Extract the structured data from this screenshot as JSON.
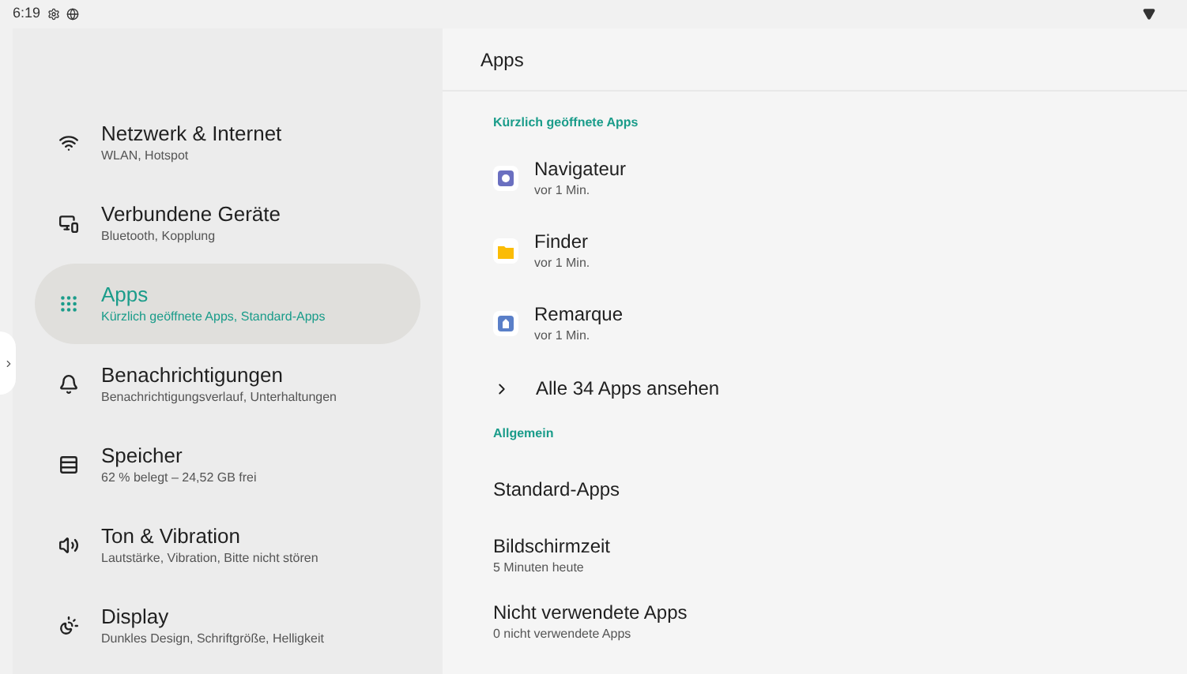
{
  "status_bar": {
    "time": "6:19"
  },
  "sidebar": {
    "items": [
      {
        "kind": "wifi",
        "title": "Netzwerk & Internet",
        "subtitle": "WLAN, Hotspot",
        "selected": false
      },
      {
        "kind": "devices",
        "title": "Verbundene Geräte",
        "subtitle": "Bluetooth, Kopplung",
        "selected": false
      },
      {
        "kind": "apps",
        "title": "Apps",
        "subtitle": "Kürzlich geöffnete Apps, Standard-Apps",
        "selected": true
      },
      {
        "kind": "bell",
        "title": "Benachrichtigungen",
        "subtitle": "Benachrichtigungsverlauf, Unterhaltungen",
        "selected": false
      },
      {
        "kind": "storage",
        "title": "Speicher",
        "subtitle": "62 % belegt – 24,52 GB frei",
        "selected": false
      },
      {
        "kind": "sound",
        "title": "Ton & Vibration",
        "subtitle": "Lautstärke, Vibration, Bitte nicht stören",
        "selected": false
      },
      {
        "kind": "display",
        "title": "Display",
        "subtitle": "Dunkles Design, Schriftgröße, Helligkeit",
        "selected": false
      }
    ]
  },
  "page": {
    "title": "Apps",
    "recent": {
      "heading": "Kürzlich geöffnete Apps",
      "apps": [
        {
          "kind": "circle",
          "name": "Navigateur",
          "time": "vor 1 Min.",
          "color": "#6a6fc0"
        },
        {
          "kind": "folder",
          "name": "Finder",
          "time": "vor 1 Min.",
          "color": "#fbbc05"
        },
        {
          "kind": "house",
          "name": "Remarque",
          "time": "vor 1 Min.",
          "color": "#5a7fc8"
        }
      ],
      "see_all": "Alle 34 Apps ansehen"
    },
    "general": {
      "heading": "Allgemein",
      "items": [
        {
          "title": "Standard-Apps"
        },
        {
          "title": "Bildschirmzeit",
          "subtitle": "5 Minuten heute"
        },
        {
          "title": "Nicht verwendete Apps",
          "subtitle": "0 nicht verwendete Apps"
        }
      ]
    }
  }
}
